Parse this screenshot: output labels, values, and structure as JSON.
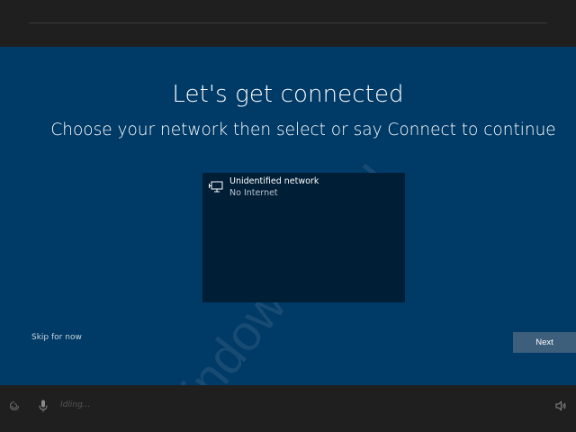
{
  "header": {
    "title": "Let's get connected",
    "subtitle": "Choose your network then select or say Connect to continue"
  },
  "networks": [
    {
      "name": "Unidentified network",
      "status": "No Internet",
      "icon": "wired-network-icon"
    }
  ],
  "actions": {
    "skip_label": "Skip for now",
    "next_label": "Next"
  },
  "watermark": "windowstips.ru",
  "bottom_bar": {
    "status_text": "Idling...",
    "icons": [
      "ease-of-access-icon",
      "microphone-icon",
      "volume-icon"
    ]
  },
  "colors": {
    "background": "#003a66",
    "panel": "#001e36",
    "bar": "#1f1f1f",
    "button": "#3d5f7c"
  }
}
